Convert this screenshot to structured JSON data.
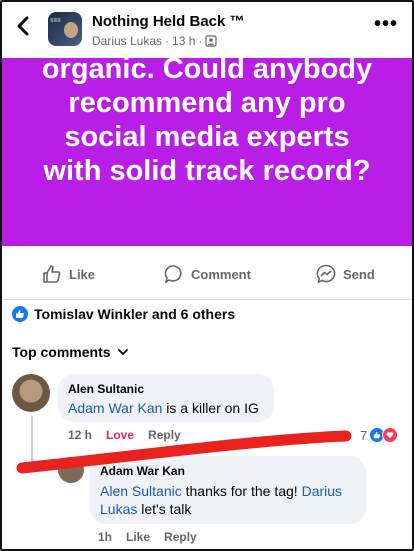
{
  "header": {
    "group_name": "Nothing Held Back ™",
    "author": "Darius Lukas",
    "time": "13 h",
    "separator": "·",
    "more_label": "•••"
  },
  "post": {
    "lines": [
      "organic. Could anybody",
      "recommend any pro",
      "social media experts",
      "with solid track record?"
    ],
    "background_color": "#b81ee6"
  },
  "actions": {
    "like": "Like",
    "comment": "Comment",
    "send": "Send"
  },
  "reactions": {
    "summary": "Tomislav Winkler and 6 others"
  },
  "top_comments_label": "Top comments",
  "comments": [
    {
      "author": "Alen Sultanic",
      "mention": "Adam War Kan",
      "text": " is a killer on IG",
      "time": "12 h",
      "love": "Love",
      "reply": "Reply",
      "reaction_count": "7"
    }
  ],
  "reply": {
    "author": "Adam War Kan",
    "mention1": "Alen Sultanic",
    "text1": " thanks for the tag! ",
    "mention2": "Darius Lukas",
    "text2": " let's talk",
    "time": "1h",
    "like": "Like",
    "reply": "Reply"
  },
  "colors": {
    "accent_blue": "#1877f2",
    "mention_blue": "#1a5ca8",
    "love_red": "#e0245e",
    "marker_red": "#e8231d"
  }
}
